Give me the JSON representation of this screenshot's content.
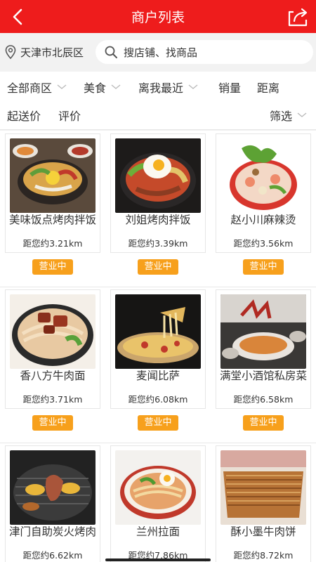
{
  "header": {
    "title": "商户列表",
    "back_icon": "chevron-left-icon",
    "share_icon": "share-icon",
    "bg_color": "#ee1c1c"
  },
  "location": {
    "city": "天津市北辰区",
    "icon": "location-pin-icon"
  },
  "search": {
    "placeholder": "搜店铺、找商品",
    "icon": "search-icon"
  },
  "filters": {
    "all_areas": "全部商区",
    "food": "美食",
    "nearest": "离我最近",
    "sales": "销量",
    "distance": "距离",
    "min_delivery": "起送价",
    "rating": "评价",
    "filter": "筛选"
  },
  "status_color": "#f7a01c",
  "merchants": [
    {
      "name": "美味饭点烤肉拌饭",
      "distance": "距您约3.21km",
      "status": "营业中"
    },
    {
      "name": "刘姐烤肉拌饭",
      "distance": "距您约3.39km",
      "status": "营业中"
    },
    {
      "name": "赵小川麻辣烫",
      "distance": "距您约3.56km",
      "status": "营业中"
    },
    {
      "name": "香八方牛肉面",
      "distance": "距您约3.71km",
      "status": "营业中"
    },
    {
      "name": "麦闻比萨",
      "distance": "距您约6.08km",
      "status": "营业中"
    },
    {
      "name": "满堂小酒馆私房菜",
      "distance": "距您约6.58km",
      "status": "营业中"
    },
    {
      "name": "津门自助炭火烤肉",
      "distance": "距您约6.62km"
    },
    {
      "name": "兰州拉面",
      "distance": "距您约7.86km"
    },
    {
      "name": "酥小墨牛肉饼",
      "distance": "距您约8.72km"
    }
  ]
}
